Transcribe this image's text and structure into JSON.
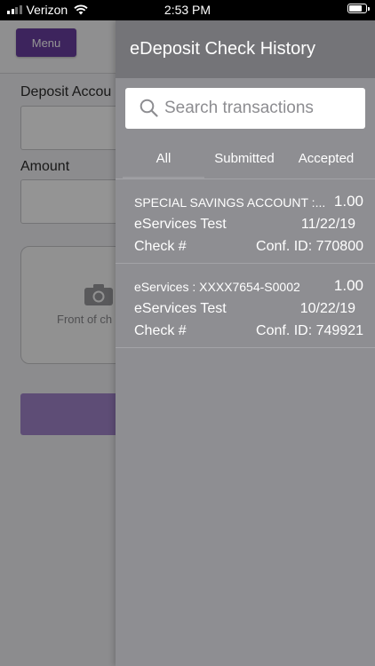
{
  "status_bar": {
    "carrier": "Verizon",
    "time": "2:53 PM",
    "battery_level": 0.85
  },
  "background": {
    "menu_label": "Menu",
    "deposit_account_label": "Deposit Accou",
    "amount_label": "Amount",
    "front_of_check_label": "Front of ch"
  },
  "drawer": {
    "title": "eDeposit Check History",
    "search": {
      "placeholder": "Search transactions",
      "value": ""
    },
    "tabs": [
      {
        "label": "All",
        "active": true
      },
      {
        "label": "Submitted",
        "active": false
      },
      {
        "label": "Accepted",
        "active": false
      }
    ],
    "transactions": [
      {
        "account": "SPECIAL SAVINGS ACCOUNT :...",
        "amount": "1.00",
        "name": "eServices Test",
        "date": "11/22/19",
        "check": "Check #",
        "conf": "Conf. ID: 770800"
      },
      {
        "account": "eServices  : XXXX7654-S0002",
        "amount": "1.00",
        "name": "eServices Test",
        "date": "10/22/19",
        "check": "Check #",
        "conf": "Conf. ID: 749921"
      }
    ]
  },
  "colors": {
    "brand_purple": "#6a3fa0",
    "drawer_bg": "#8e8e92",
    "drawer_header_bg": "#747478"
  },
  "icons": {
    "search": "search-icon",
    "camera": "camera-icon",
    "wifi": "wifi-icon",
    "signal": "signal-icon",
    "battery": "battery-icon"
  }
}
